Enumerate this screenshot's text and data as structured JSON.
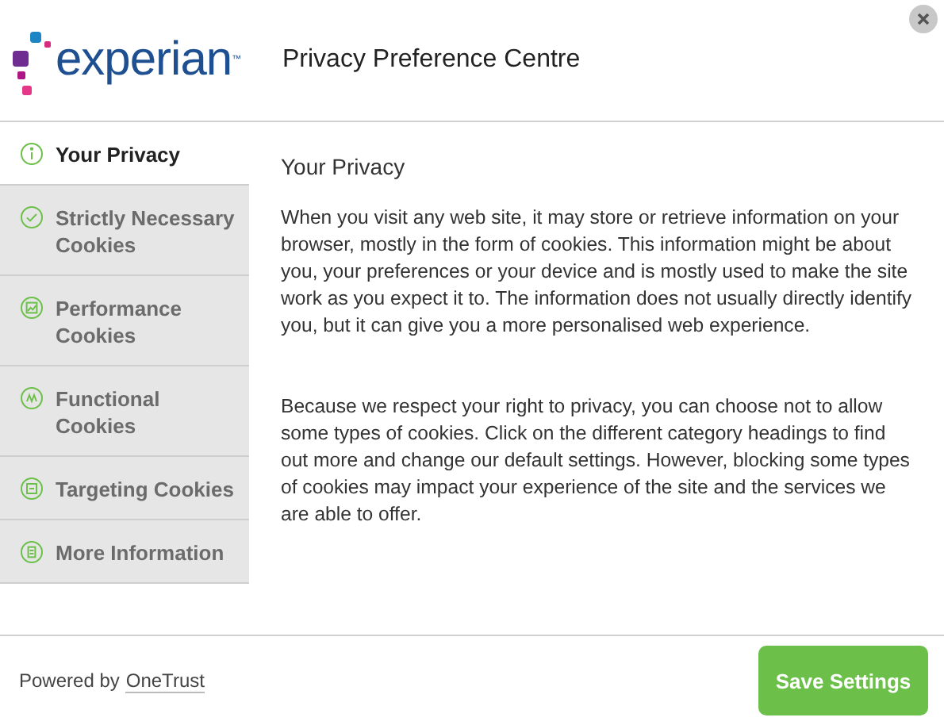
{
  "logo": {
    "text": "experian",
    "mark": "™"
  },
  "header": {
    "title": "Privacy Preference Centre"
  },
  "sidebar": {
    "items": [
      {
        "label": "Your Privacy",
        "selected": true
      },
      {
        "label": "Strictly Necessary Cookies",
        "selected": false
      },
      {
        "label": "Performance Cookies",
        "selected": false
      },
      {
        "label": "Functional Cookies",
        "selected": false
      },
      {
        "label": "Targeting Cookies",
        "selected": false
      },
      {
        "label": "More Information",
        "selected": false
      }
    ]
  },
  "content": {
    "heading": "Your Privacy",
    "paragraphs": [
      "When you visit any web site, it may store or retrieve information on your browser, mostly in the form of cookies. This information might be about you, your preferences or your device and is mostly used to make the site work as you expect it to. The information does not usually directly identify you, but it can give you a more personalised web experience.",
      "Because we respect your right to privacy, you can choose not to allow some types of cookies. Click on the different category headings to find out more and change our default settings. However, blocking some types of cookies may impact your experience of the site and the services we are able to offer."
    ]
  },
  "footer": {
    "powered_by": "Powered by",
    "link": "OneTrust",
    "button": "Save Settings"
  }
}
